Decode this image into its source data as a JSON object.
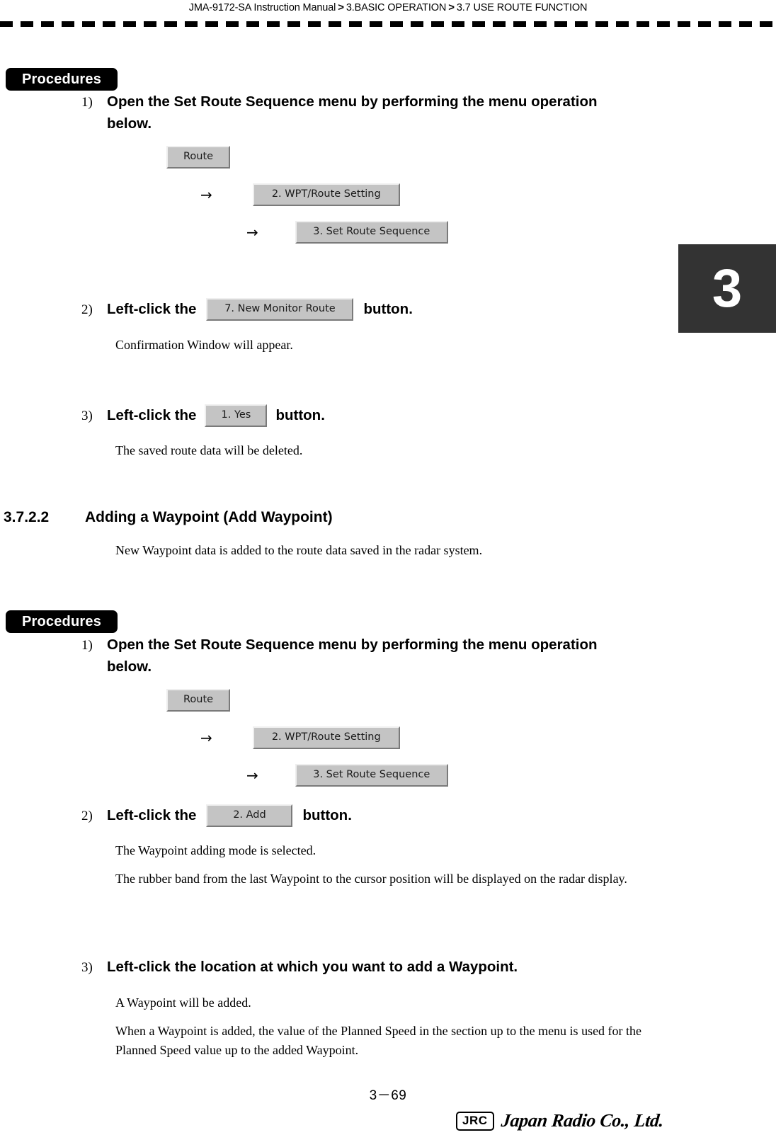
{
  "header": {
    "part1": "JMA-9172-SA Instruction Manual",
    "sep1": ">",
    "part2": "3.BASIC OPERATION",
    "sep2": ">",
    "part3": "3.7  USE ROUTE FUNCTION"
  },
  "chapter_tab": {
    "number": "3"
  },
  "section1": {
    "procedures_label": "Procedures",
    "step1": {
      "number": "1)",
      "text": "Open the Set Route Sequence menu by performing the menu operation below."
    },
    "menu_path": {
      "root_button": "Route",
      "arrow": "→",
      "level2_button": "2. WPT/Route Setting",
      "level3_button": "3. Set Route Sequence"
    },
    "step2": {
      "number": "2)",
      "prefix": "Left-click the",
      "button": "7. New Monitor Route",
      "suffix": "button.",
      "note": "Confirmation Window will appear."
    },
    "step3": {
      "number": "3)",
      "prefix": "Left-click the",
      "button": "1. Yes",
      "suffix": "button.",
      "note": "The saved route data will be deleted."
    }
  },
  "section2": {
    "heading_number": "3.7.2.2",
    "heading_title": "Adding a Waypoint (Add Waypoint)",
    "intro": "New Waypoint data is added to the route data saved in the radar system.",
    "procedures_label": "Procedures",
    "step1": {
      "number": "1)",
      "text": "Open the Set Route Sequence menu by performing the menu operation below."
    },
    "menu_path": {
      "root_button": "Route",
      "arrow": "→",
      "level2_button": "2. WPT/Route Setting",
      "level3_button": "3. Set Route Sequence"
    },
    "step2": {
      "number": "2)",
      "prefix": "Left-click the",
      "button": "2. Add",
      "suffix": "button.",
      "note1": "The Waypoint adding mode is selected.",
      "note2": "The rubber band from the last Waypoint to the cursor position will be displayed on the radar display."
    },
    "step3": {
      "number": "3)",
      "text": "Left-click the location at which you want to add a Waypoint.",
      "note1": "A Waypoint will be added.",
      "note2": "When a Waypoint is added, the value of the Planned Speed in the section up to the menu is used for the Planned Speed value up to the added Waypoint."
    }
  },
  "footer": {
    "page_number": "3－69",
    "logo_mark": "JRC",
    "logo_name": "Japan Radio Co., Ltd."
  }
}
